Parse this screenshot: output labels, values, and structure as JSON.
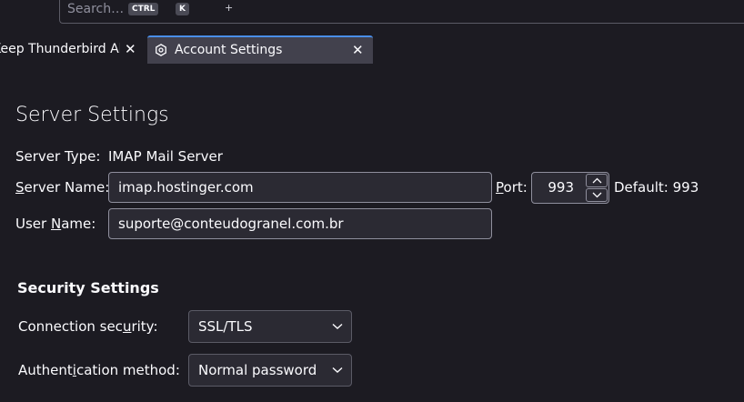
{
  "search": {
    "placeholder": "Search…",
    "shortcut_key1": "CTRL",
    "shortcut_plus": "+",
    "shortcut_key2": "K"
  },
  "tabs": [
    {
      "label": "Keep Thunderbird Alive",
      "close": "✕"
    },
    {
      "label": "Account Settings",
      "close": "✕",
      "icon": "gear-icon"
    }
  ],
  "server": {
    "title": "Server Settings",
    "type_label": "Server Type:",
    "type_value": "IMAP Mail Server",
    "name_label_pre": "S",
    "name_label_post": "erver Name:",
    "name_value": "imap.hostinger.com",
    "port_label_pre": "P",
    "port_label_post": "ort:",
    "port_value": "993",
    "default_port": "Default: 993",
    "user_label_pre": "User ",
    "user_label_u": "N",
    "user_label_post": "ame:",
    "user_value": "suporte@conteudogranel.com.br"
  },
  "security": {
    "title": "Security Settings",
    "conn_label_pre": "Connection sec",
    "conn_label_u": "u",
    "conn_label_post": "rity:",
    "conn_value": "SSL/TLS",
    "auth_label_pre": "Authent",
    "auth_label_u": "i",
    "auth_label_post": "cation method:",
    "auth_value": "Normal password"
  },
  "colors": {
    "accent": "#4a8ee8",
    "background": "#1c1b22",
    "field": "#2b2a33"
  }
}
